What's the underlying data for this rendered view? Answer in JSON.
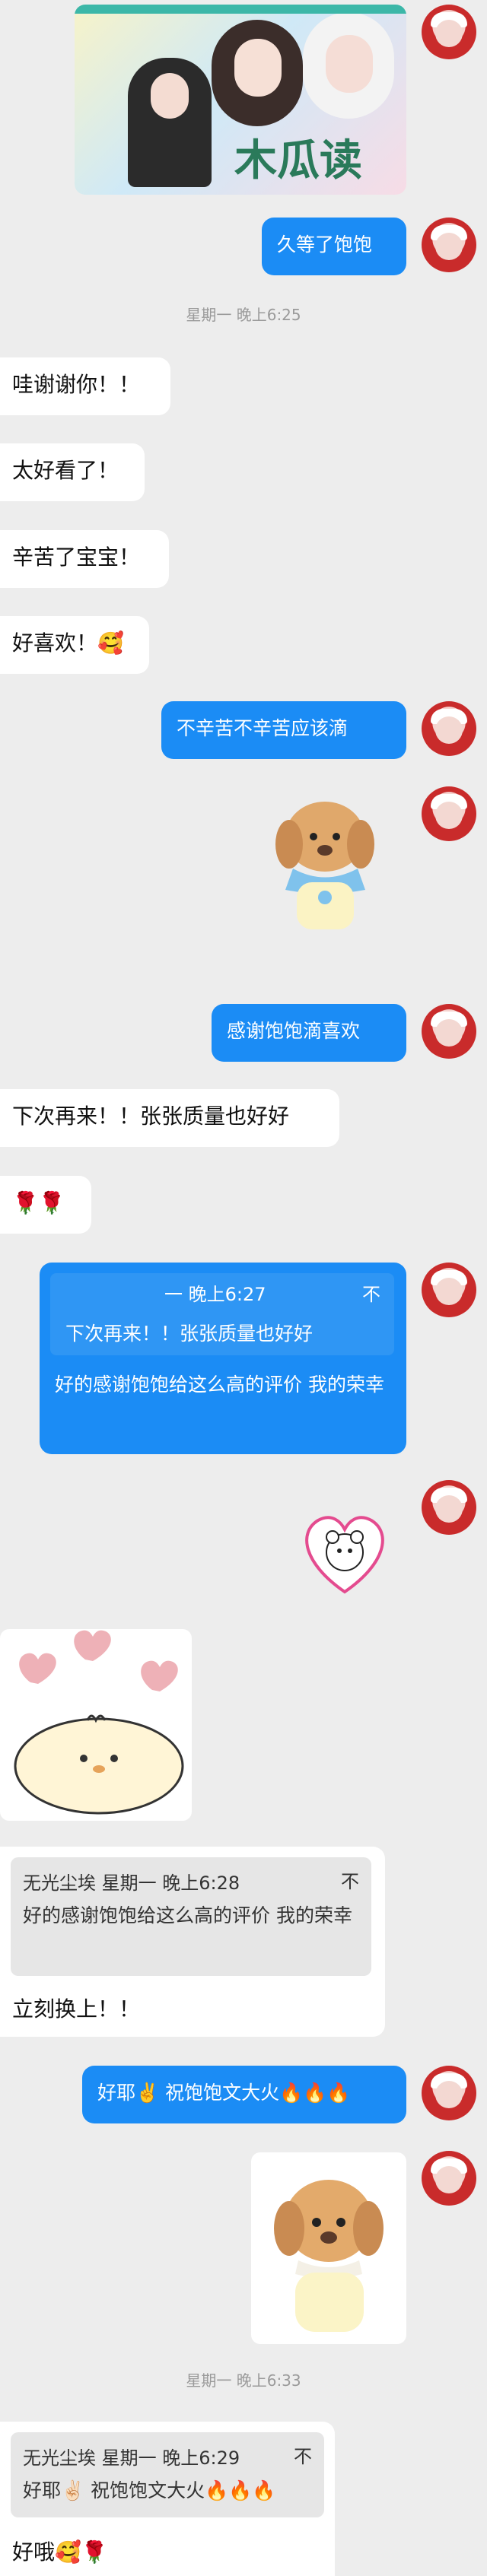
{
  "banner": {
    "title_text": "木瓜读"
  },
  "messages": {
    "m1": "久等了饱饱",
    "t1": "星期一 晚上6:25",
    "m2": "哇谢谢你！！",
    "m3": "太好看了！",
    "m4": "辛苦了宝宝！",
    "m5": "好喜欢！🥰",
    "m6": "不辛苦不辛苦应该滴",
    "m7": "感谢饱饱滴喜欢",
    "m8": "下次再来！！张张质量也好好",
    "m9": "🌹🌹",
    "r1_head": "一 晚上6:27",
    "r1_close": "不",
    "r1_quote": "下次再来！！张张质量也好好",
    "r1_text": "好的感谢饱饱给这么高的评价 我的荣幸",
    "q2_head": "无光尘埃  星期一 晚上6:28",
    "q2_close": "不",
    "q2_body": "好的感谢饱饱给这么高的评价 我的荣幸",
    "m10": "立刻换上！！",
    "m11": "好耶✌️ 祝饱饱文大火🔥🔥🔥",
    "t2": "星期一 晚上6:33",
    "q3_head": "无光尘埃  星期一 晚上6:29",
    "q3_close": "不",
    "q3_body": "好耶✌🏻 祝饱饱文大火🔥🔥🔥",
    "m12": "好哦🥰🌹"
  },
  "colors": {
    "accent": "#1b8cf5",
    "background": "#ededed"
  }
}
